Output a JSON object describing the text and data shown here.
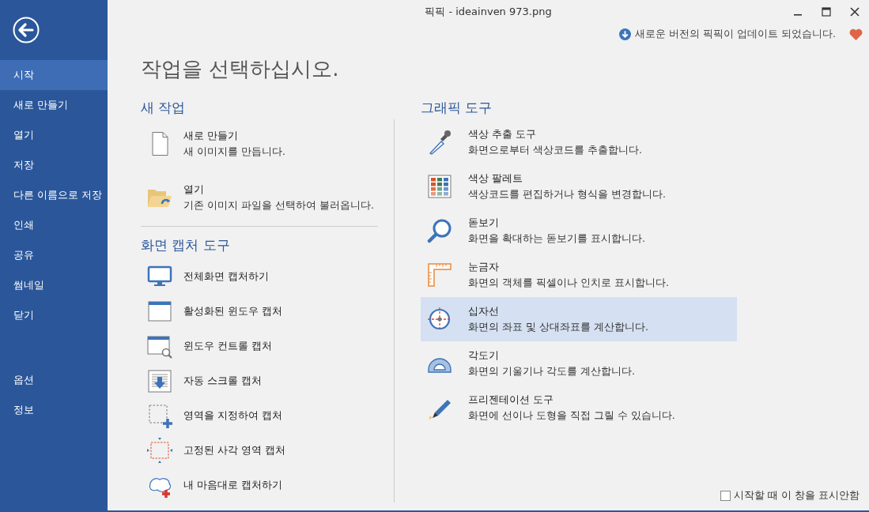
{
  "window": {
    "title": "픽픽 - ideainven 973.png"
  },
  "sidebar": {
    "items": [
      {
        "label": "시작",
        "selected": true
      },
      {
        "label": "새로 만들기",
        "selected": false
      },
      {
        "label": "열기",
        "selected": false
      },
      {
        "label": "저장",
        "selected": false
      },
      {
        "label": "다른 이름으로 저장",
        "selected": false
      },
      {
        "label": "인쇄",
        "selected": false
      },
      {
        "label": "공유",
        "selected": false
      },
      {
        "label": "썸네일",
        "selected": false
      },
      {
        "label": "닫기",
        "selected": false
      }
    ],
    "bottom_items": [
      {
        "label": "옵션",
        "selected": false
      },
      {
        "label": "정보",
        "selected": false
      }
    ]
  },
  "update_notice": "새로운 버전의 픽픽이 업데이트 되었습니다.",
  "heading": "작업을 선택하십시오.",
  "new_task": {
    "title": "새 작업",
    "items": [
      {
        "title": "새로 만들기",
        "description": "새 이미지를 만듭니다."
      },
      {
        "title": "열기",
        "description": "기존 이미지 파일을 선택하여 불러옵니다."
      }
    ]
  },
  "capture_tools": {
    "title": "화면 캡처 도구",
    "items": [
      "전체화면 캡처하기",
      "활성화된 윈도우 캡처",
      "윈도우 컨트롤 캡처",
      "자동 스크롤 캡처",
      "영역을 지정하여 캡처",
      "고정된 사각 영역 캡처",
      "내 마음대로 캡처하기"
    ]
  },
  "graphic_tools": {
    "title": "그래픽 도구",
    "items": [
      {
        "title": "색상 추출 도구",
        "description": "화면으로부터 색상코드를 추출합니다.",
        "selected": false
      },
      {
        "title": "색상 팔레트",
        "description": "색상코드를 편집하거나 형식을 변경합니다.",
        "selected": false
      },
      {
        "title": "돋보기",
        "description": "화면을 확대하는 돋보기를 표시합니다.",
        "selected": false
      },
      {
        "title": "눈금자",
        "description": "화면의 객체를 픽셀이나 인치로 표시합니다.",
        "selected": false
      },
      {
        "title": "십자선",
        "description": "화면의 좌표 및 상대좌표를 계산합니다.",
        "selected": true
      },
      {
        "title": "각도기",
        "description": "화면의 기울기나 각도를 계산합니다.",
        "selected": false
      },
      {
        "title": "프리젠테이션 도구",
        "description": "화면에 선이나 도형을 직접 그릴 수 있습니다.",
        "selected": false
      }
    ]
  },
  "startup_option": {
    "label": "시작할 때 이 창을 표시안함",
    "checked": false
  }
}
